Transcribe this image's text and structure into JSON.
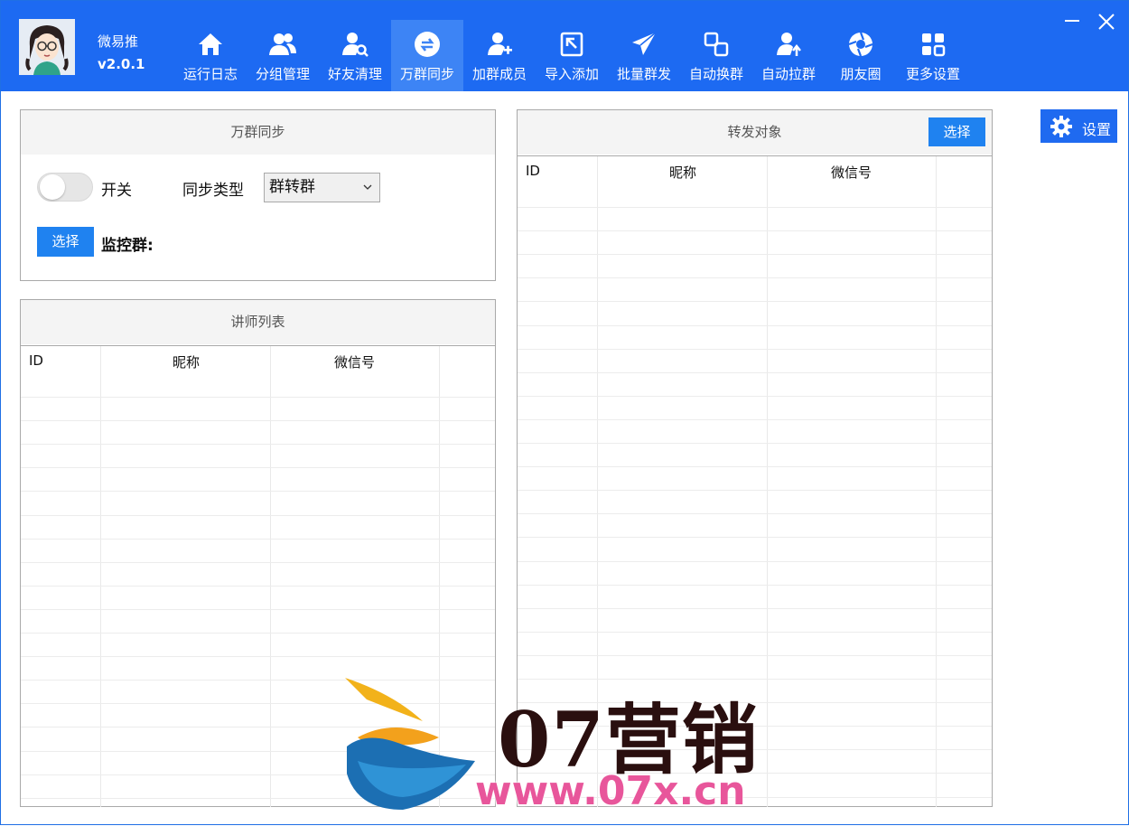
{
  "app": {
    "name": "微易推",
    "version": "v2.0.1"
  },
  "nav": [
    {
      "label": "运行日志",
      "icon": "home-icon",
      "active": false
    },
    {
      "label": "分组管理",
      "icon": "users-icon",
      "active": false
    },
    {
      "label": "好友清理",
      "icon": "user-search-icon",
      "active": false
    },
    {
      "label": "万群同步",
      "icon": "sync-icon",
      "active": true
    },
    {
      "label": "加群成员",
      "icon": "user-add-icon",
      "active": false
    },
    {
      "label": "导入添加",
      "icon": "import-icon",
      "active": false
    },
    {
      "label": "批量群发",
      "icon": "send-icon",
      "active": false
    },
    {
      "label": "自动换群",
      "icon": "switch-icon",
      "active": false
    },
    {
      "label": "自动拉群",
      "icon": "user-pull-icon",
      "active": false
    },
    {
      "label": "朋友圈",
      "icon": "aperture-icon",
      "active": false
    },
    {
      "label": "更多设置",
      "icon": "grid-icon",
      "active": false
    }
  ],
  "sync_panel": {
    "title": "万群同步",
    "switch_label": "开关",
    "switch_on": false,
    "type_label": "同步类型",
    "type_value": "群转群",
    "select_button": "选择",
    "monitor_label": "监控群:"
  },
  "teacher_panel": {
    "title": "讲师列表",
    "columns": [
      "ID",
      "昵称",
      "微信号"
    ]
  },
  "forward_panel": {
    "title": "转发对象",
    "select_button": "选择",
    "columns": [
      "ID",
      "昵称",
      "微信号"
    ]
  },
  "settings_button": "设置",
  "watermark": {
    "main": "07营销",
    "url": "www.07x.cn"
  },
  "colors": {
    "titlebar": "#1d6af2",
    "active_tab": "#3d84f5",
    "button": "#1f82f0"
  }
}
